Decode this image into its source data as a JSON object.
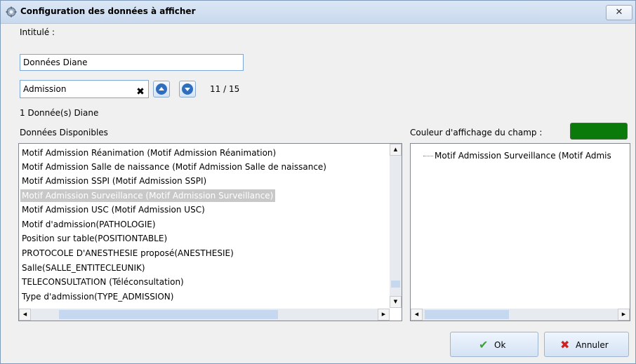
{
  "window": {
    "title": "Configuration des données à afficher",
    "close_label": "✕"
  },
  "form": {
    "title_label": "Intitulé :",
    "title_value": "Données Diane",
    "search_value": "Admission",
    "clear_glyph": "✖",
    "match_counter": "11 / 15",
    "count_label": "1 Donnée(s) Diane",
    "available_label": "Données Disponibles",
    "color_label": "Couleur d'affichage du champ :",
    "field_color": "#0a7a0a"
  },
  "available_list": {
    "items": [
      "Motif Admission Réanimation (Motif Admission Réanimation)",
      "Motif Admission Salle de naissance (Motif Admission Salle de naissance)",
      "Motif Admission SSPI (Motif Admission SSPI)",
      "Motif Admission Surveillance (Motif Admission Surveillance)",
      "Motif Admission USC (Motif Admission USC)",
      "Motif d'admission(PATHOLOGIE)",
      "Position sur table(POSITIONTABLE)",
      "PROTOCOLE D'ANESTHESIE proposé(ANESTHESIE)",
      "Salle(SALLE_ENTITECLEUNIK)",
      "TELECONSULTATION (Téléconsultation)",
      "Type d'admission(TYPE_ADMISSION)"
    ],
    "selected_index": 3
  },
  "selected_tree": {
    "items": [
      "Motif Admission Surveillance (Motif Admis"
    ]
  },
  "buttons": {
    "ok_label": "Ok",
    "cancel_label": "Annuler",
    "ok_icon": "checkmark-icon",
    "cancel_icon": "red-x-icon"
  },
  "colors": {
    "accent": "#2f6ebf",
    "ok_check": "#3ca03c",
    "cancel_x": "#d02020"
  }
}
